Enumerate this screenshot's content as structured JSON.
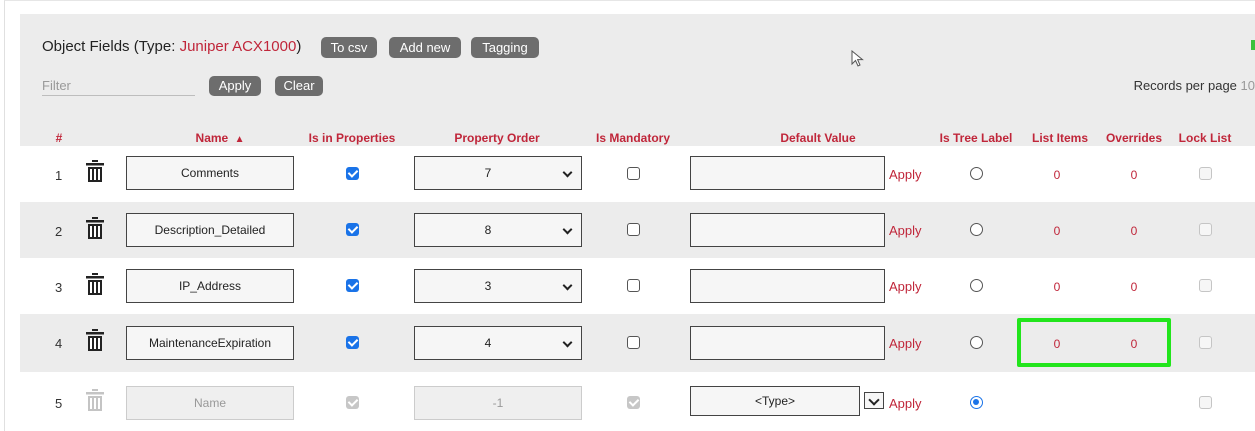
{
  "header": {
    "title_prefix": "Object Fields (Type: ",
    "type_name": "Juniper ACX1000",
    "title_suffix": ")",
    "buttons": {
      "to_csv": "To csv",
      "add_new": "Add new",
      "tagging": "Tagging"
    }
  },
  "filter": {
    "placeholder": "Filter",
    "apply": "Apply",
    "clear": "Clear"
  },
  "records_per_page": {
    "label": "Records per page",
    "value": "10"
  },
  "columns": {
    "index": "#",
    "name": "Name",
    "sort_indicator": "▲",
    "is_in_properties": "Is in Properties",
    "property_order": "Property Order",
    "is_mandatory": "Is Mandatory",
    "default_value": "Default Value",
    "is_tree_label": "Is Tree Label",
    "list_items": "List Items",
    "overrides": "Overrides",
    "lock_list": "Lock List"
  },
  "rows": [
    {
      "index": "1",
      "name": "Comments",
      "property_order": "7",
      "apply": "Apply",
      "list_items": "0",
      "overrides": "0"
    },
    {
      "index": "2",
      "name": "Description_Detailed",
      "property_order": "8",
      "apply": "Apply",
      "list_items": "0",
      "overrides": "0"
    },
    {
      "index": "3",
      "name": "IP_Address",
      "property_order": "3",
      "apply": "Apply",
      "list_items": "0",
      "overrides": "0"
    },
    {
      "index": "4",
      "name": "MaintenanceExpiration",
      "property_order": "4",
      "apply": "Apply",
      "list_items": "0",
      "overrides": "0"
    },
    {
      "index": "5",
      "name": "Name",
      "property_order": "-1",
      "default_type": "<Type>",
      "apply": "Apply"
    }
  ],
  "colors": {
    "accent": "#c0263a",
    "checkbox": "#1a73e8",
    "pill": "#6d6d6d",
    "highlight": "#22e51c"
  }
}
